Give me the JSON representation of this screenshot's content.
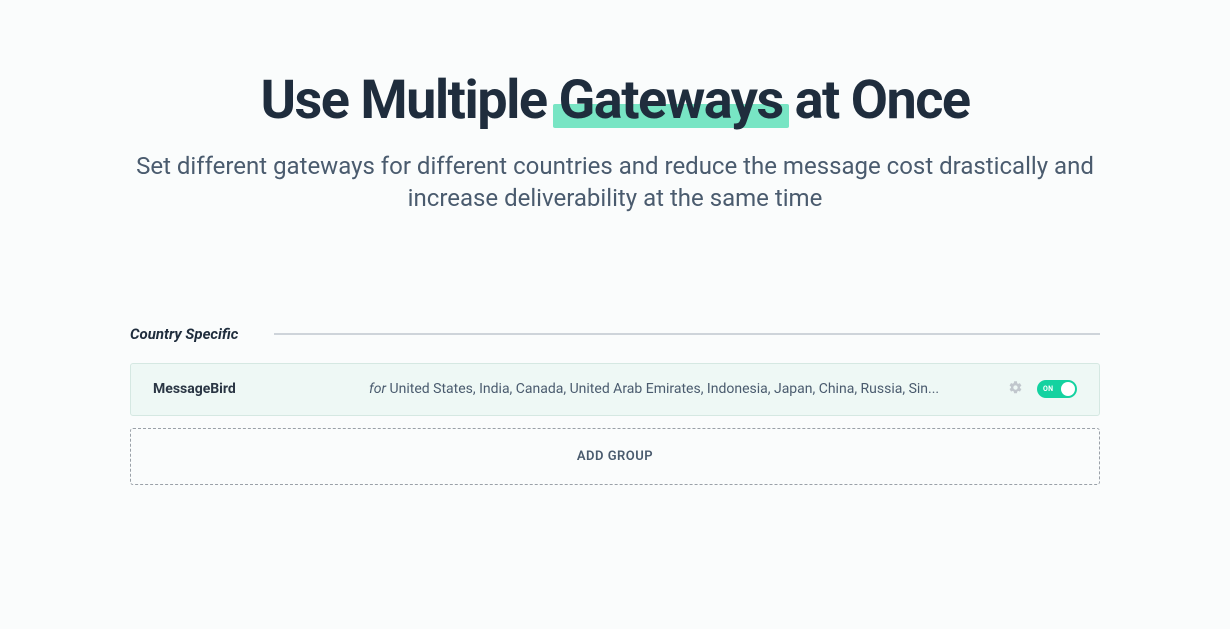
{
  "hero": {
    "title_pre": "Use Multiple ",
    "title_highlight": "Gateways",
    "title_post": " at Once",
    "subtitle": "Set different gateways for different countries and reduce the message cost drastically and increase deliverability at the same time"
  },
  "section": {
    "label": "Country Specific",
    "gateway": {
      "name": "MessageBird",
      "for_label": "for",
      "countries": " United States, India, Canada, United Arab Emirates, Indonesia, Japan, China, Russia, Sin...",
      "toggle_state": "ON"
    },
    "add_group_label": "ADD GROUP"
  }
}
